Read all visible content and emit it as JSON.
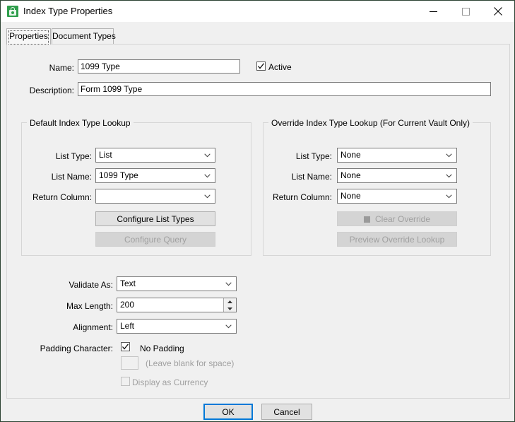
{
  "window": {
    "title": "Index Type Properties",
    "icon": "lock-icon",
    "controls": {
      "minimize": "minimize-icon",
      "maximize": "maximize-icon",
      "close": "close-icon"
    },
    "border_color": "#2b4232"
  },
  "tabs": [
    {
      "label": "Properties",
      "selected": true
    },
    {
      "label": "Document Types",
      "selected": false
    }
  ],
  "form": {
    "name_label": "Name:",
    "name_value": "1099 Type",
    "active_label": "Active",
    "active_checked": true,
    "description_label": "Description:",
    "description_value": "Form 1099 Type"
  },
  "default_lookup": {
    "title": "Default Index Type Lookup",
    "list_type_label": "List Type:",
    "list_type_value": "List",
    "list_name_label": "List Name:",
    "list_name_value": "1099 Type",
    "return_column_label": "Return Column:",
    "return_column_value": "",
    "configure_list_types_label": "Configure List Types",
    "configure_query_label": "Configure Query",
    "configure_query_enabled": false
  },
  "override_lookup": {
    "title": "Override Index Type Lookup (For Current Vault Only)",
    "list_type_label": "List Type:",
    "list_type_value": "None",
    "list_name_label": "List Name:",
    "list_name_value": "None",
    "return_column_label": "Return Column:",
    "return_column_value": "None",
    "clear_override_label": "Clear Override",
    "clear_override_enabled": false,
    "preview_override_lookup_label": "Preview Override Lookup",
    "preview_override_lookup_enabled": false
  },
  "validation": {
    "validate_as_label": "Validate As:",
    "validate_as_value": "Text",
    "max_length_label": "Max Length:",
    "max_length_value": "200",
    "alignment_label": "Alignment:",
    "alignment_value": "Left",
    "padding_character_label": "Padding Character:",
    "no_padding_label": "No Padding",
    "no_padding_checked": true,
    "padding_char_value": "",
    "padding_char_enabled": false,
    "leave_blank_hint": "(Leave blank for space)",
    "display_as_currency_label": "Display as Currency",
    "display_as_currency_checked": false,
    "display_as_currency_enabled": false
  },
  "footer": {
    "ok_label": "OK",
    "cancel_label": "Cancel",
    "accent_color": "#0078d7"
  }
}
